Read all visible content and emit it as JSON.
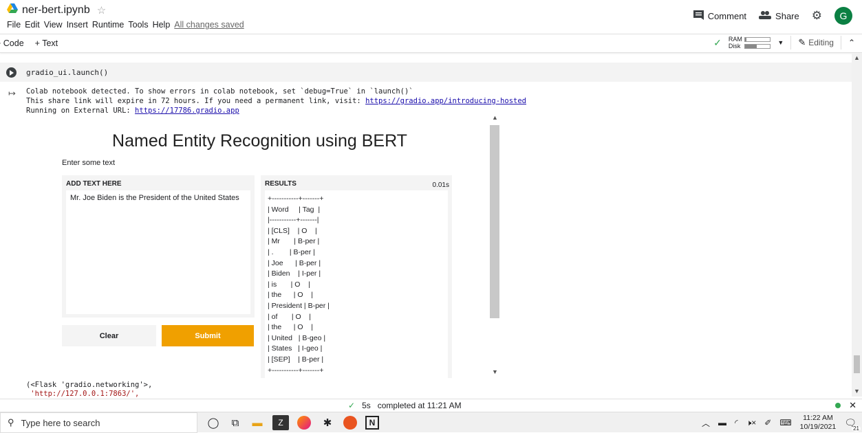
{
  "header": {
    "notebook_title": "ner-bert.ipynb",
    "menu": [
      "File",
      "Edit",
      "View",
      "Insert",
      "Runtime",
      "Tools",
      "Help"
    ],
    "saved_status": "All changes saved",
    "comment_label": "Comment",
    "share_label": "Share",
    "avatar_letter": "G"
  },
  "toolbar": {
    "add_code": "+ Code",
    "add_text": "+ Text",
    "ram_label": "RAM",
    "disk_label": "Disk",
    "ram_fill": 0.05,
    "disk_fill": 0.45,
    "editing_label": "Editing"
  },
  "cell": {
    "code": "gradio_ui.launch()",
    "output_lines": [
      "Colab notebook detected. To show errors in colab notebook, set `debug=True` in `launch()`",
      "This share link will expire in 72 hours. If you need a permanent link, visit: ",
      "Running on External URL: "
    ],
    "link_hosted": "https://gradio.app/introducing-hosted",
    "link_external": "https://17786.gradio.app",
    "return_line1": "(<Flask 'gradio.networking'>,",
    "return_line2": " 'http://127.0.0.1:7863/',"
  },
  "gradio": {
    "title": "Named Entity Recognition using BERT",
    "subtitle": "Enter some text",
    "input_label": "ADD TEXT HERE",
    "input_value": "Mr. Joe Biden is the President of the United States",
    "clear_label": "Clear",
    "submit_label": "Submit",
    "output_label": "RESULTS",
    "output_time": "0.01s",
    "result_text": "+-----------+-------+\n| Word     | Tag  |\n|-----------+-------|\n| [CLS]    | O    |\n| Mr       | B-per |\n| .        | B-per |\n| Joe      | B-per |\n| Biden    | I-per |\n| is       | O    |\n| the      | O    |\n| President | B-per |\n| of       | O    |\n| the      | O    |\n| United   | B-geo |\n| States   | I-geo |\n| [SEP]    | B-per |\n+-----------+-------+"
  },
  "status_bar": {
    "duration": "5s",
    "completed": "completed at 11:21 AM"
  },
  "taskbar": {
    "search_placeholder": "Type here to search",
    "time": "11:22 AM",
    "date": "10/19/2021",
    "notification_count": "21"
  }
}
